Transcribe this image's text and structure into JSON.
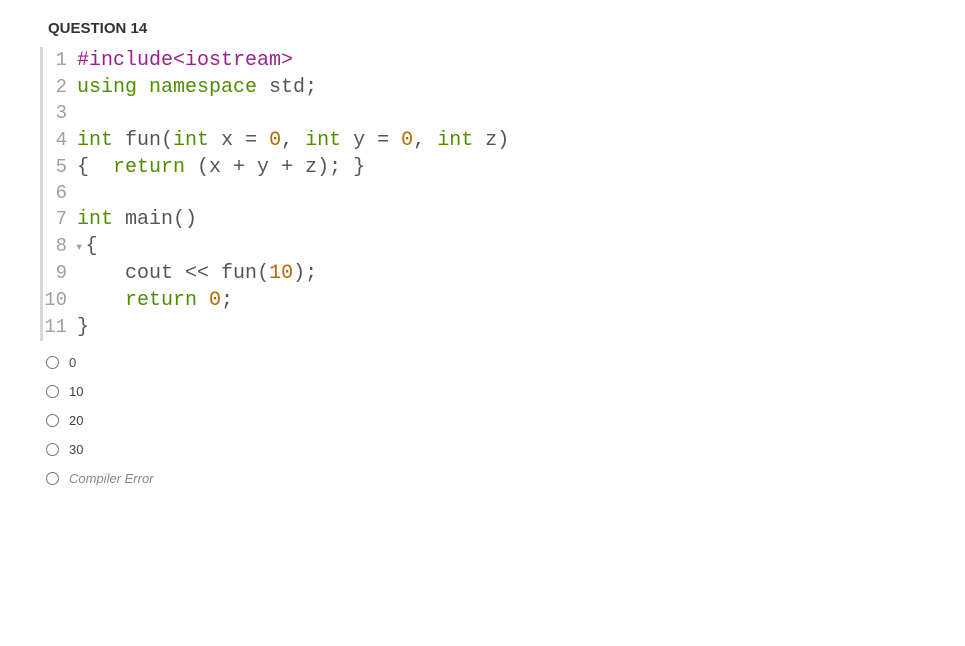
{
  "question": {
    "title": "QUESTION 14"
  },
  "code": {
    "lines": [
      {
        "num": "1",
        "fold": "",
        "tokens": [
          {
            "cls": "tk-preproc",
            "t": "#include<iostream>"
          }
        ]
      },
      {
        "num": "2",
        "fold": "",
        "tokens": [
          {
            "cls": "tk-keyword",
            "t": "using "
          },
          {
            "cls": "tk-keyword",
            "t": "namespace "
          },
          {
            "cls": "tk-ident",
            "t": "std"
          },
          {
            "cls": "tk-punct",
            "t": ";"
          }
        ]
      },
      {
        "num": "3",
        "fold": "",
        "tokens": []
      },
      {
        "num": "4",
        "fold": "",
        "tokens": [
          {
            "cls": "tk-type",
            "t": "int "
          },
          {
            "cls": "tk-ident",
            "t": "fun"
          },
          {
            "cls": "tk-punct",
            "t": "("
          },
          {
            "cls": "tk-type",
            "t": "int "
          },
          {
            "cls": "tk-ident",
            "t": "x "
          },
          {
            "cls": "tk-punct",
            "t": "= "
          },
          {
            "cls": "tk-number",
            "t": "0"
          },
          {
            "cls": "tk-punct",
            "t": ", "
          },
          {
            "cls": "tk-type",
            "t": "int "
          },
          {
            "cls": "tk-ident",
            "t": "y "
          },
          {
            "cls": "tk-punct",
            "t": "= "
          },
          {
            "cls": "tk-number",
            "t": "0"
          },
          {
            "cls": "tk-punct",
            "t": ", "
          },
          {
            "cls": "tk-type",
            "t": "int "
          },
          {
            "cls": "tk-ident",
            "t": "z"
          },
          {
            "cls": "tk-punct",
            "t": ")"
          }
        ]
      },
      {
        "num": "5",
        "fold": "",
        "tokens": [
          {
            "cls": "tk-punct",
            "t": "{  "
          },
          {
            "cls": "tk-keyword",
            "t": "return "
          },
          {
            "cls": "tk-punct",
            "t": "(x "
          },
          {
            "cls": "tk-punct",
            "t": "+ y "
          },
          {
            "cls": "tk-punct",
            "t": "+ z); }"
          }
        ]
      },
      {
        "num": "6",
        "fold": "",
        "tokens": []
      },
      {
        "num": "7",
        "fold": "",
        "tokens": [
          {
            "cls": "tk-type",
            "t": "int "
          },
          {
            "cls": "tk-ident",
            "t": "main"
          },
          {
            "cls": "tk-punct",
            "t": "()"
          }
        ]
      },
      {
        "num": "8",
        "fold": "▾",
        "tokens": [
          {
            "cls": "tk-punct",
            "t": "{"
          }
        ]
      },
      {
        "num": "9",
        "fold": "",
        "tokens": [
          {
            "cls": "tk-default",
            "t": "    cout "
          },
          {
            "cls": "tk-punct",
            "t": "<< "
          },
          {
            "cls": "tk-ident",
            "t": "fun"
          },
          {
            "cls": "tk-punct",
            "t": "("
          },
          {
            "cls": "tk-number",
            "t": "10"
          },
          {
            "cls": "tk-punct",
            "t": ");"
          }
        ]
      },
      {
        "num": "10",
        "fold": "",
        "tokens": [
          {
            "cls": "tk-default",
            "t": "    "
          },
          {
            "cls": "tk-keyword",
            "t": "return "
          },
          {
            "cls": "tk-number",
            "t": "0"
          },
          {
            "cls": "tk-punct",
            "t": ";"
          }
        ]
      },
      {
        "num": "11",
        "fold": "",
        "tokens": [
          {
            "cls": "tk-punct",
            "t": "}"
          }
        ]
      }
    ]
  },
  "options": [
    {
      "label": "0",
      "italic": false
    },
    {
      "label": "10",
      "italic": false
    },
    {
      "label": "20",
      "italic": false
    },
    {
      "label": "30",
      "italic": false
    },
    {
      "label": "Compiler Error",
      "italic": true
    }
  ]
}
